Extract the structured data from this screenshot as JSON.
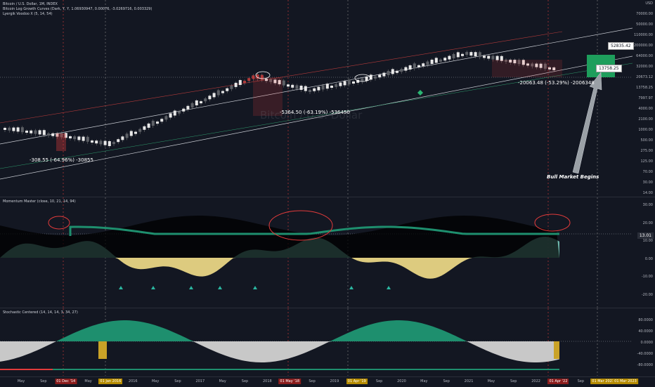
{
  "main": {
    "legend_title": "Bitcoin / U.S. Dollar, 1M, INDEX",
    "legend_line2": "Bitcoin Log Growth Curves (Dark, Y, Y, 1.06930947, 0.00076, -3.0269716, 0.003329)",
    "legend_line3": "Lyergik Voodoo X (5, 14, 54)",
    "watermark": "Bitcoin / U.S. Dollar",
    "price_ticks": [
      "USD",
      "70000.00",
      "50000.00",
      "110000.00",
      "200000.00",
      "64000.00",
      "32000.00",
      "20673.12",
      "13758.25",
      "7997.97",
      "4000.00",
      "2100.00",
      "1000.00",
      "500.00",
      "275.00",
      "125.00",
      "70.00",
      "30.00",
      "14.00"
    ],
    "annotations": {
      "drawdown_2014": "-308.55 (-64.96%) -30855",
      "drawdown_2018": "-5364.50 (-63.19%) -536450",
      "drawdown_2022": "-20063.48 (-53.29%) -2006348",
      "bull_text": "Bull Market Begins"
    },
    "price_top": "52835.42",
    "price_bottom": "13758.25"
  },
  "momentum": {
    "legend": "Momentum Master (close, 10, 21, 14, 94)",
    "ticks": [
      "30.00",
      "20.00",
      "10.00",
      "0.00",
      "-10.00",
      "-20.00"
    ],
    "value_badge": "13.01"
  },
  "stochastic": {
    "legend": "Stochastic Centered (14, 14, 14, 3, 34, 27)",
    "ticks": [
      "80.0000",
      "40.0000",
      "0.0000",
      "-40.0000",
      "-80.0000"
    ]
  },
  "time_axis": [
    {
      "label": "May",
      "hl": ""
    },
    {
      "label": "Sep",
      "hl": ""
    },
    {
      "label": "01 Dec '14",
      "hl": "red"
    },
    {
      "label": "May",
      "hl": ""
    },
    {
      "label": "01 Jan 2016",
      "hl": "yellow"
    },
    {
      "label": "2016",
      "hl": ""
    },
    {
      "label": "May",
      "hl": ""
    },
    {
      "label": "Sep",
      "hl": ""
    },
    {
      "label": "2017",
      "hl": ""
    },
    {
      "label": "May",
      "hl": ""
    },
    {
      "label": "Sep",
      "hl": ""
    },
    {
      "label": "2018",
      "hl": ""
    },
    {
      "label": "01 May '18",
      "hl": "red"
    },
    {
      "label": "Sep",
      "hl": ""
    },
    {
      "label": "2019",
      "hl": ""
    },
    {
      "label": "01 Apr '19",
      "hl": "yellow"
    },
    {
      "label": "Sep",
      "hl": ""
    },
    {
      "label": "2020",
      "hl": ""
    },
    {
      "label": "May",
      "hl": ""
    },
    {
      "label": "Sep",
      "hl": ""
    },
    {
      "label": "2021",
      "hl": ""
    },
    {
      "label": "May",
      "hl": ""
    },
    {
      "label": "Sep",
      "hl": ""
    },
    {
      "label": "2022",
      "hl": ""
    },
    {
      "label": "01 Apr '22",
      "hl": "red"
    },
    {
      "label": "Sep",
      "hl": ""
    },
    {
      "label": "01 Mar 2023",
      "hl": "yellow"
    },
    {
      "label": "01 Mar 2023",
      "hl": "yellow"
    }
  ],
  "colors": {
    "bg": "#131722",
    "teal": "#1e8f6e",
    "aqua": "#7fd6c6",
    "yellow": "#f4df8a",
    "red": "#e23b3b",
    "gold": "#c9a227"
  }
}
